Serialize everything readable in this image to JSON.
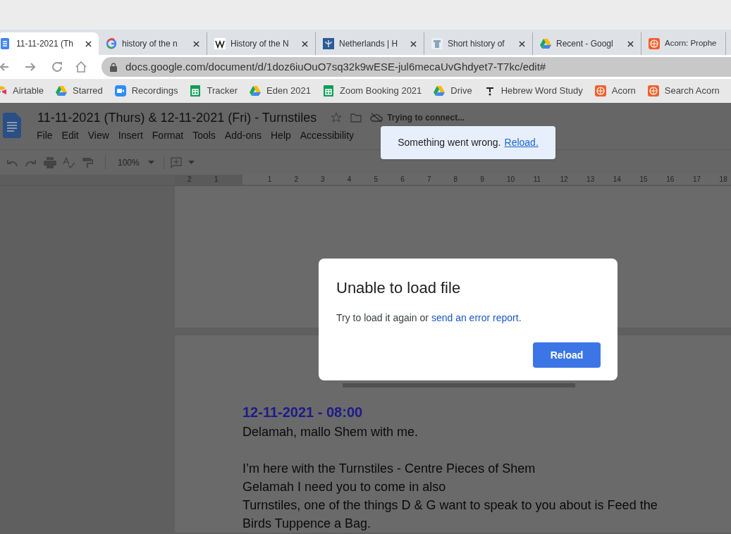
{
  "tabs": [
    {
      "title": "11-11-2021 (Th",
      "selected": true
    },
    {
      "title": "history of the n",
      "selected": false
    },
    {
      "title": "History of the N",
      "selected": false
    },
    {
      "title": "Netherlands | H",
      "selected": false
    },
    {
      "title": "Short history of",
      "selected": false
    },
    {
      "title": "Recent - Googl",
      "selected": false
    },
    {
      "title": "Acorn: Prophe",
      "selected": false
    }
  ],
  "address_bar": {
    "url": "docs.google.com/document/d/1doz6iuOuO7sq32k9wESE-jul6mecaUvGhdyet7-T7kc/edit#"
  },
  "bookmarks": [
    {
      "label": "Airtable"
    },
    {
      "label": "Starred"
    },
    {
      "label": "Recordings"
    },
    {
      "label": "Tracker"
    },
    {
      "label": "Eden 2021"
    },
    {
      "label": "Zoom Booking 2021"
    },
    {
      "label": "Drive"
    },
    {
      "label": "Hebrew Word Study"
    },
    {
      "label": "Acorn"
    },
    {
      "label": "Search Acorn"
    }
  ],
  "document": {
    "title": "11-11-2021 (Thurs) & 12-11-2021 (Fri) - Turnstiles",
    "status": "Trying to connect...",
    "menu": [
      "File",
      "Edit",
      "View",
      "Insert",
      "Format",
      "Tools",
      "Add-ons",
      "Help",
      "Accessibility"
    ],
    "zoom": "100%",
    "ruler": [
      "2",
      "1",
      "1",
      "2",
      "3",
      "4",
      "5",
      "6",
      "7",
      "8",
      "9",
      "10",
      "11",
      "12",
      "13",
      "14",
      "15",
      "16",
      "17",
      "18"
    ],
    "section_heading": "12-11-2021 - 08:00",
    "paragraphs": [
      "Delamah, mallo Shem with me.",
      "I’m here with the Turnstiles - Centre Pieces of Shem\nGelamah I need you to come in also\nTurnstiles, one of the things D  & G want to speak to you about is Feed the Birds Tuppence a Bag."
    ]
  },
  "toast": {
    "message": "Something went wrong.",
    "link": "Reload."
  },
  "dialog": {
    "title": "Unable to load file",
    "text": "Try to load it again or ",
    "link": "send an error report",
    "text_end": ".",
    "button": "Reload"
  }
}
